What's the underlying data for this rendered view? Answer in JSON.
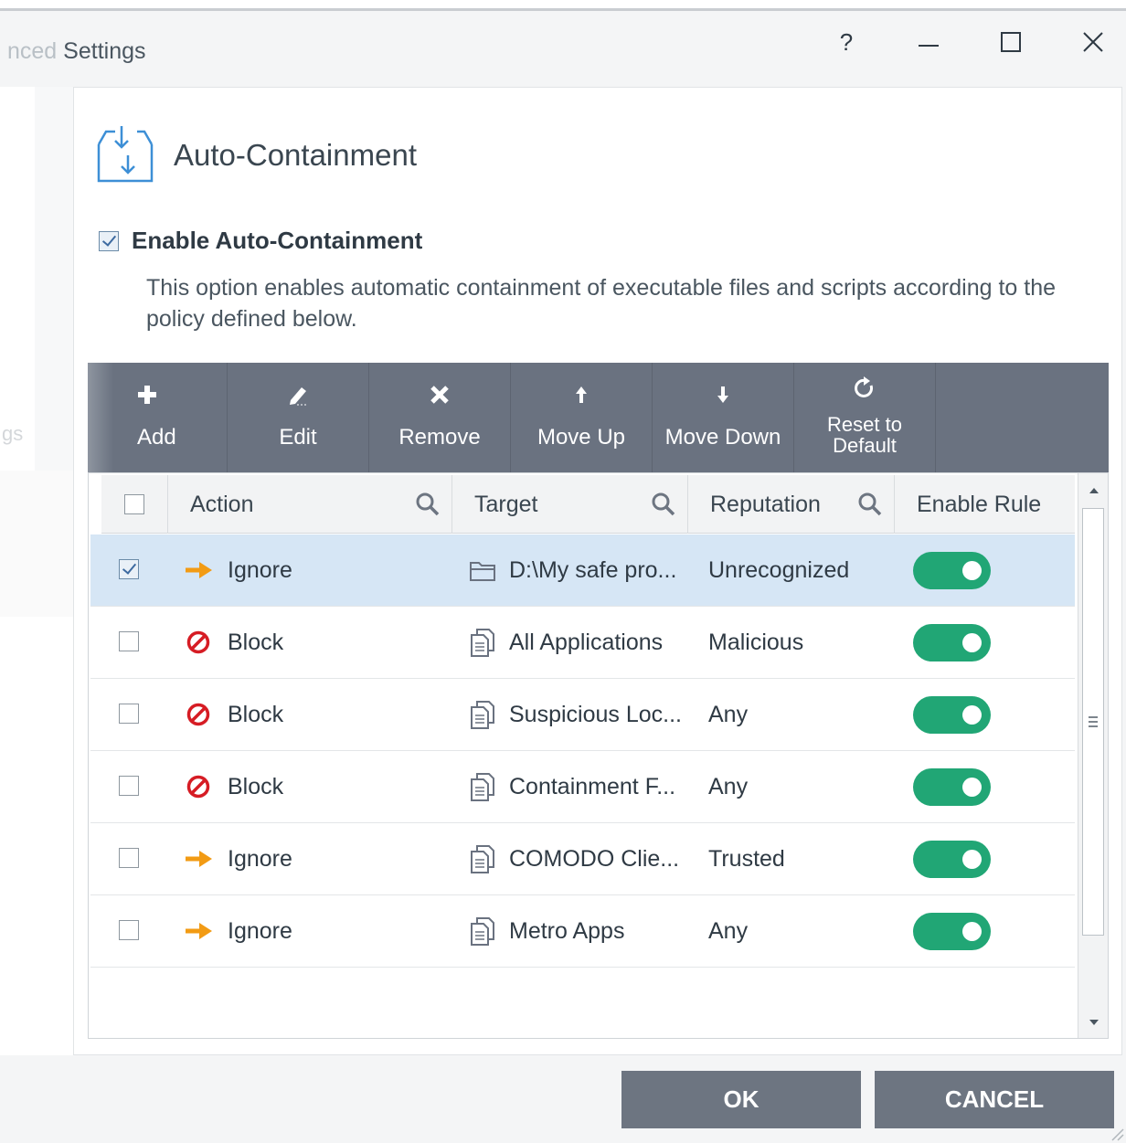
{
  "window": {
    "title_prefix": "nced",
    "title_rest": " Settings",
    "help_label": "?",
    "left_panel_fragment": "gs"
  },
  "section": {
    "title": "Auto-Containment",
    "icon": "container-download-icon"
  },
  "enable": {
    "label": "Enable Auto-Containment",
    "checked": true,
    "description": "This option enables automatic containment of executable files and scripts according to the policy defined below."
  },
  "toolbar": {
    "add": "Add",
    "edit": "Edit",
    "remove": "Remove",
    "move_up": "Move Up",
    "move_down": "Move Down",
    "reset_line1": "Reset to",
    "reset_line2": "Default"
  },
  "columns": {
    "action": "Action",
    "target": "Target",
    "reputation": "Reputation",
    "enable_rule": "Enable Rule"
  },
  "rows": [
    {
      "checked": true,
      "action": "Ignore",
      "action_icon": "arrow-right-icon",
      "target": "D:\\My safe pro...",
      "target_icon": "folder-icon",
      "reputation": "Unrecognized",
      "enabled": true
    },
    {
      "checked": false,
      "action": "Block",
      "action_icon": "block-icon",
      "target": "All Applications",
      "target_icon": "file-group-icon",
      "reputation": "Malicious",
      "enabled": true
    },
    {
      "checked": false,
      "action": "Block",
      "action_icon": "block-icon",
      "target": "Suspicious Loc...",
      "target_icon": "file-group-icon",
      "reputation": "Any",
      "enabled": true
    },
    {
      "checked": false,
      "action": "Block",
      "action_icon": "block-icon",
      "target": "Containment F...",
      "target_icon": "file-group-icon",
      "reputation": "Any",
      "enabled": true
    },
    {
      "checked": false,
      "action": "Ignore",
      "action_icon": "arrow-right-icon",
      "target": "COMODO Clie...",
      "target_icon": "file-group-icon",
      "reputation": "Trusted",
      "enabled": true
    },
    {
      "checked": false,
      "action": "Ignore",
      "action_icon": "arrow-right-icon",
      "target": "Metro Apps",
      "target_icon": "file-group-icon",
      "reputation": "Any",
      "enabled": true
    }
  ],
  "buttons": {
    "ok": "OK",
    "cancel": "CANCEL"
  },
  "colors": {
    "toolbar": "#6a7280",
    "toggle_on": "#21a675",
    "selected_row": "#d6e6f5",
    "ignore_arrow": "#f29b14",
    "block_icon": "#d61c24",
    "icon_blue": "#3d8fd6"
  }
}
